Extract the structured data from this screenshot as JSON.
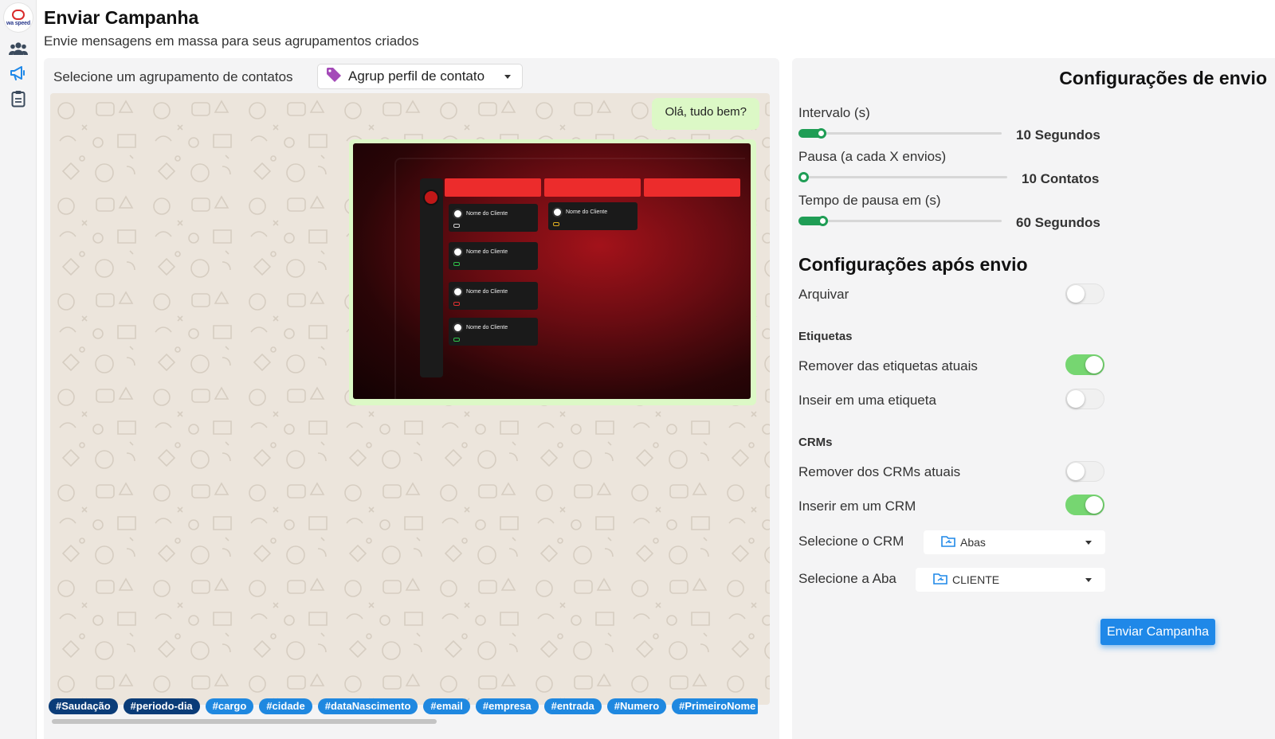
{
  "brand": {
    "logo_text": "wa speed"
  },
  "nav": [
    "users-icon",
    "megaphone-icon",
    "clipboard-icon"
  ],
  "header": {
    "title": "Enviar Campanha",
    "subtitle": "Envie mensagens em massa para seus agrupamentos criados"
  },
  "grouping": {
    "label": "Selecione um agrupamento de contatos",
    "selected": "Agrup perfil de contato"
  },
  "preview": {
    "message": "Olá, tudo bem?",
    "image_cards": [
      "Nome do Cliente",
      "Nome do Cliente",
      "Nome do Cliente",
      "Nome do Cliente",
      "Nome do Cliente"
    ]
  },
  "variables": [
    "#Saudação",
    "#periodo-dia",
    "#cargo",
    "#cidade",
    "#dataNascimento",
    "#email",
    "#empresa",
    "#entrada",
    "#Numero",
    "#PrimeiroNome"
  ],
  "send_settings": {
    "title": "Configurações de envio",
    "interval": {
      "label": "Intervalo (s)",
      "value": "10 Segundos",
      "level": 0.09
    },
    "pause": {
      "label": "Pausa (a cada X envios)",
      "value": "10 Contatos",
      "level": 0.0
    },
    "pause_time": {
      "label": "Tempo de pausa em (s)",
      "value": "60 Segundos",
      "level": 0.1
    }
  },
  "after_send": {
    "title": "Configurações após envio",
    "archive": {
      "label": "Arquivar",
      "on": false
    },
    "labels_heading": "Etiquetas",
    "remove_labels": {
      "label": "Remover das etiquetas atuais",
      "on": true
    },
    "insert_label": {
      "label": "Inseir em uma etiqueta",
      "on": false
    },
    "crms_heading": "CRMs",
    "remove_crms": {
      "label": "Remover dos CRMs atuais",
      "on": false
    },
    "insert_crm": {
      "label": "Inserir em um CRM",
      "on": true
    },
    "select_crm": {
      "label": "Selecione o CRM",
      "value": "Abas"
    },
    "select_tab": {
      "label": "Selecione a Aba",
      "value": "CLIENTE"
    }
  },
  "actions": {
    "send": "Enviar Campanha"
  },
  "colors": {
    "accent": "#1f88e8",
    "slider": "#1f9d55",
    "toggle_on": "#76d671",
    "bubble": "#dcf8c6"
  }
}
